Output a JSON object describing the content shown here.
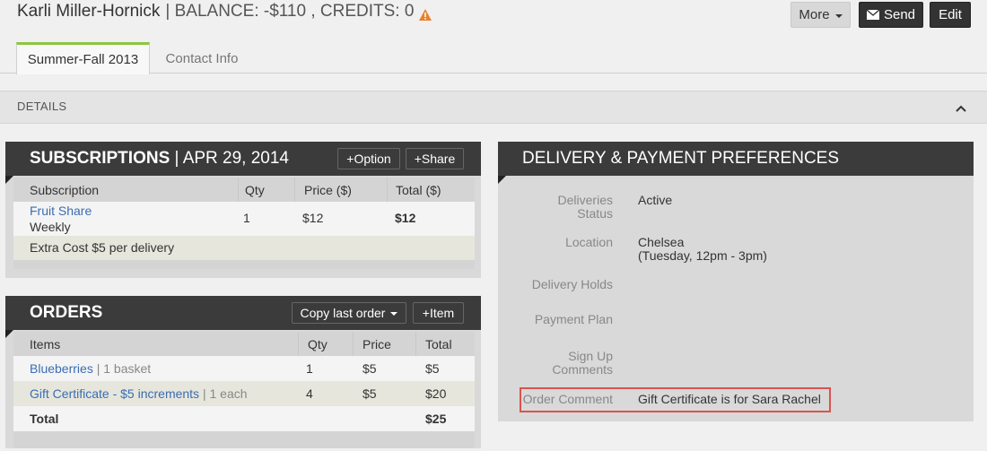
{
  "header": {
    "name": "Karli Miller-Hornick",
    "balance_text": "| BALANCE: -$110 , CREDITS: 0",
    "warning_icon": "warning-triangle",
    "warning_color": "#e8822a",
    "buttons": {
      "more": "More",
      "send": "Send",
      "edit": "Edit"
    }
  },
  "tabs": [
    {
      "label": "Summer-Fall 2013",
      "active": true
    },
    {
      "label": "Contact Info",
      "active": false
    }
  ],
  "details_bar": {
    "label": "DETAILS"
  },
  "subscriptions": {
    "title": "SUBSCRIPTIONS",
    "date": "| APR 29, 2014",
    "buttons": {
      "option": "+Option",
      "share": "+Share"
    },
    "columns": [
      "Subscription",
      "Qty",
      "Price ($)",
      "Total ($)"
    ],
    "row": {
      "name": "Fruit Share",
      "frequency": "Weekly",
      "qty": "1",
      "price": "$12",
      "total": "$12"
    },
    "extra": "Extra Cost $5 per delivery"
  },
  "orders": {
    "title": "ORDERS",
    "buttons": {
      "copy": "Copy last order",
      "item": "+Item"
    },
    "columns": [
      "Items",
      "Qty",
      "Price",
      "Total"
    ],
    "rows": [
      {
        "name": "Blueberries",
        "unit": "| 1 basket",
        "qty": "1",
        "price": "$5",
        "total": "$5"
      },
      {
        "name": "Gift Certificate - $5 increments",
        "unit": "| 1 each",
        "qty": "4",
        "price": "$5",
        "total": "$20"
      }
    ],
    "total_label": "Total",
    "total_value": "$25"
  },
  "delivery": {
    "title": "DELIVERY & PAYMENT PREFERENCES",
    "fields": {
      "deliveries_status": {
        "label_line1": "Deliveries",
        "label_line2": "Status",
        "value": "Active"
      },
      "location": {
        "label": "Location",
        "value": "Chelsea",
        "detail": "(Tuesday, 12pm - 3pm)"
      },
      "delivery_holds": {
        "label": "Delivery Holds",
        "value": ""
      },
      "payment_plan": {
        "label": "Payment Plan",
        "value": ""
      },
      "sign_up_comments": {
        "label_line1": "Sign Up",
        "label_line2": "Comments",
        "value": ""
      },
      "order_comment": {
        "label": "Order Comment",
        "value": "Gift Certificate is for Sara Rachel"
      }
    }
  },
  "colors": {
    "accent": "#8dc63f",
    "link": "#3a6db3",
    "panel_header": "#3b3b3b",
    "highlight": "#d9534f"
  }
}
